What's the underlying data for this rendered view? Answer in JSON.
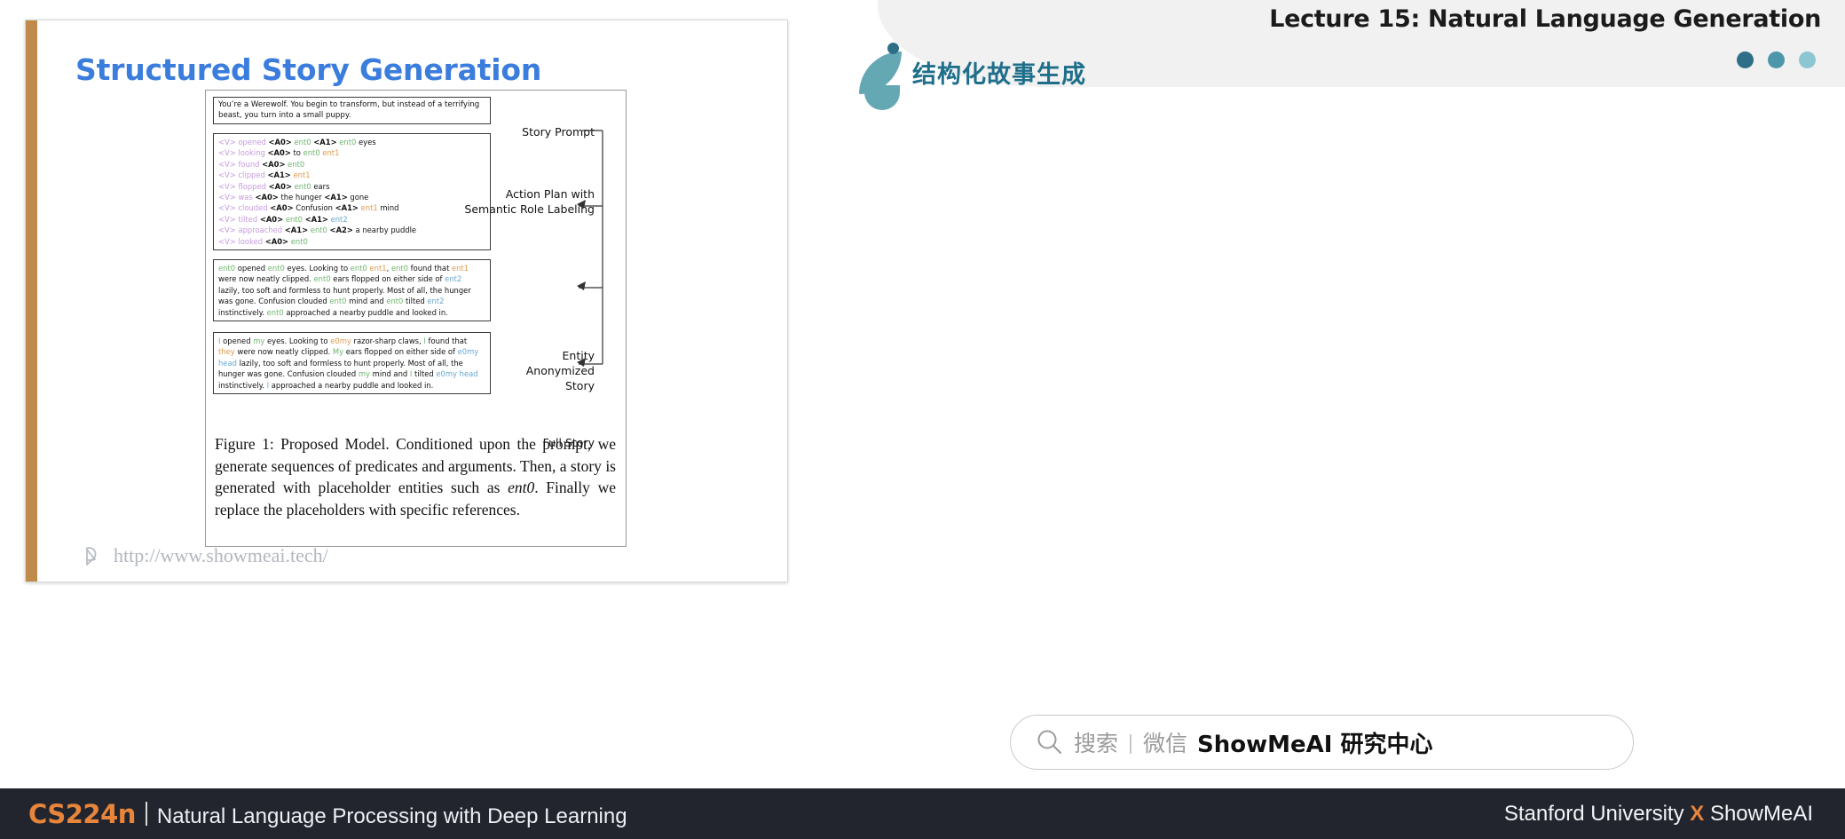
{
  "slide": {
    "title": "Structured Story Generation",
    "watermark_url": "http://www.showmeai.tech/",
    "cursor_icon": "cursor-arrow-icon"
  },
  "figure": {
    "prompt_text": "You’re a Werewolf. You begin to transform, but instead of a terrifying beast, you turn into a small puppy.",
    "action_plan": [
      "<V> opened <A0> ent0 <A1> ent0 eyes",
      "<V> looking <A0> to ent0 ent1",
      "<V> found <A0> ent0",
      "<V> clipped <A1> ent1",
      "<V> flopped <A0> ent0 ears",
      "<V> was <A0> the hunger <A1> gone",
      "<V> clouded <A0> Confusion <A1> ent1 mind",
      "<V> tilted <A0> ent0 <A1> ent2",
      "<V> approached <A1> ent0 <A2> a nearby puddle",
      "<V> looked <A0> ent0"
    ],
    "anonymized_story": "ent0 opened ent0 eyes. Looking to ent0 ent1, ent0 found that ent1 were now neatly clipped. ent0 ears flopped on either side of ent2 lazily, too soft and formless to hunt properly. Most of all, the hunger was gone. Confusion clouded ent0 mind and ent0 tilted ent2 instinctively. ent0 approached a nearby puddle and looked in.",
    "full_story": "I opened my eyes. Looking to my razor-sharp claws, I found that they were now neatly clipped. My ears flopped on either side of my head lazily, too soft and formless to hunt properly. Most of all, the hunger was gone. Confusion clouded my mind and I tilted my head instinctively. I approached a nearby puddle and looked in.",
    "labels": {
      "prompt": "Story Prompt",
      "plan": "Action Plan with Semantic Role Labeling",
      "anonymized": "Entity Anonymized Story",
      "full": "Full Story"
    },
    "caption": "Figure 1: Proposed Model. Conditioned upon the prompt, we generate sequences of predicates and arguments. Then, a story is generated with placeholder entities such as ent0. Finally we replace the placeholders with specific references.",
    "caption_italic_token": "ent0",
    "colors": {
      "verb": "#c69ae0",
      "ent0": "#6eb56e",
      "ent1": "#e09a4e",
      "ent2": "#68a7d0",
      "title": "#3b7ddd"
    }
  },
  "right_panel": {
    "lecture_title": "Lecture 15: Natural Language Generation",
    "chinese_title": "结构化故事生成",
    "dots": [
      "#2e6f87",
      "#4e97aa",
      "#8cc6d2"
    ],
    "search": {
      "icon": "search-icon",
      "placeholder": "搜索",
      "divider": "|",
      "channel": "微信",
      "brand": "ShowMeAI 研究中心"
    }
  },
  "footer": {
    "course_code": "CS224n",
    "course_name": "Natural Language Processing with Deep Learning",
    "attribution_left": "Stanford University",
    "attribution_x": "X",
    "attribution_right": "ShowMeAI",
    "accent": "#e8853a"
  }
}
